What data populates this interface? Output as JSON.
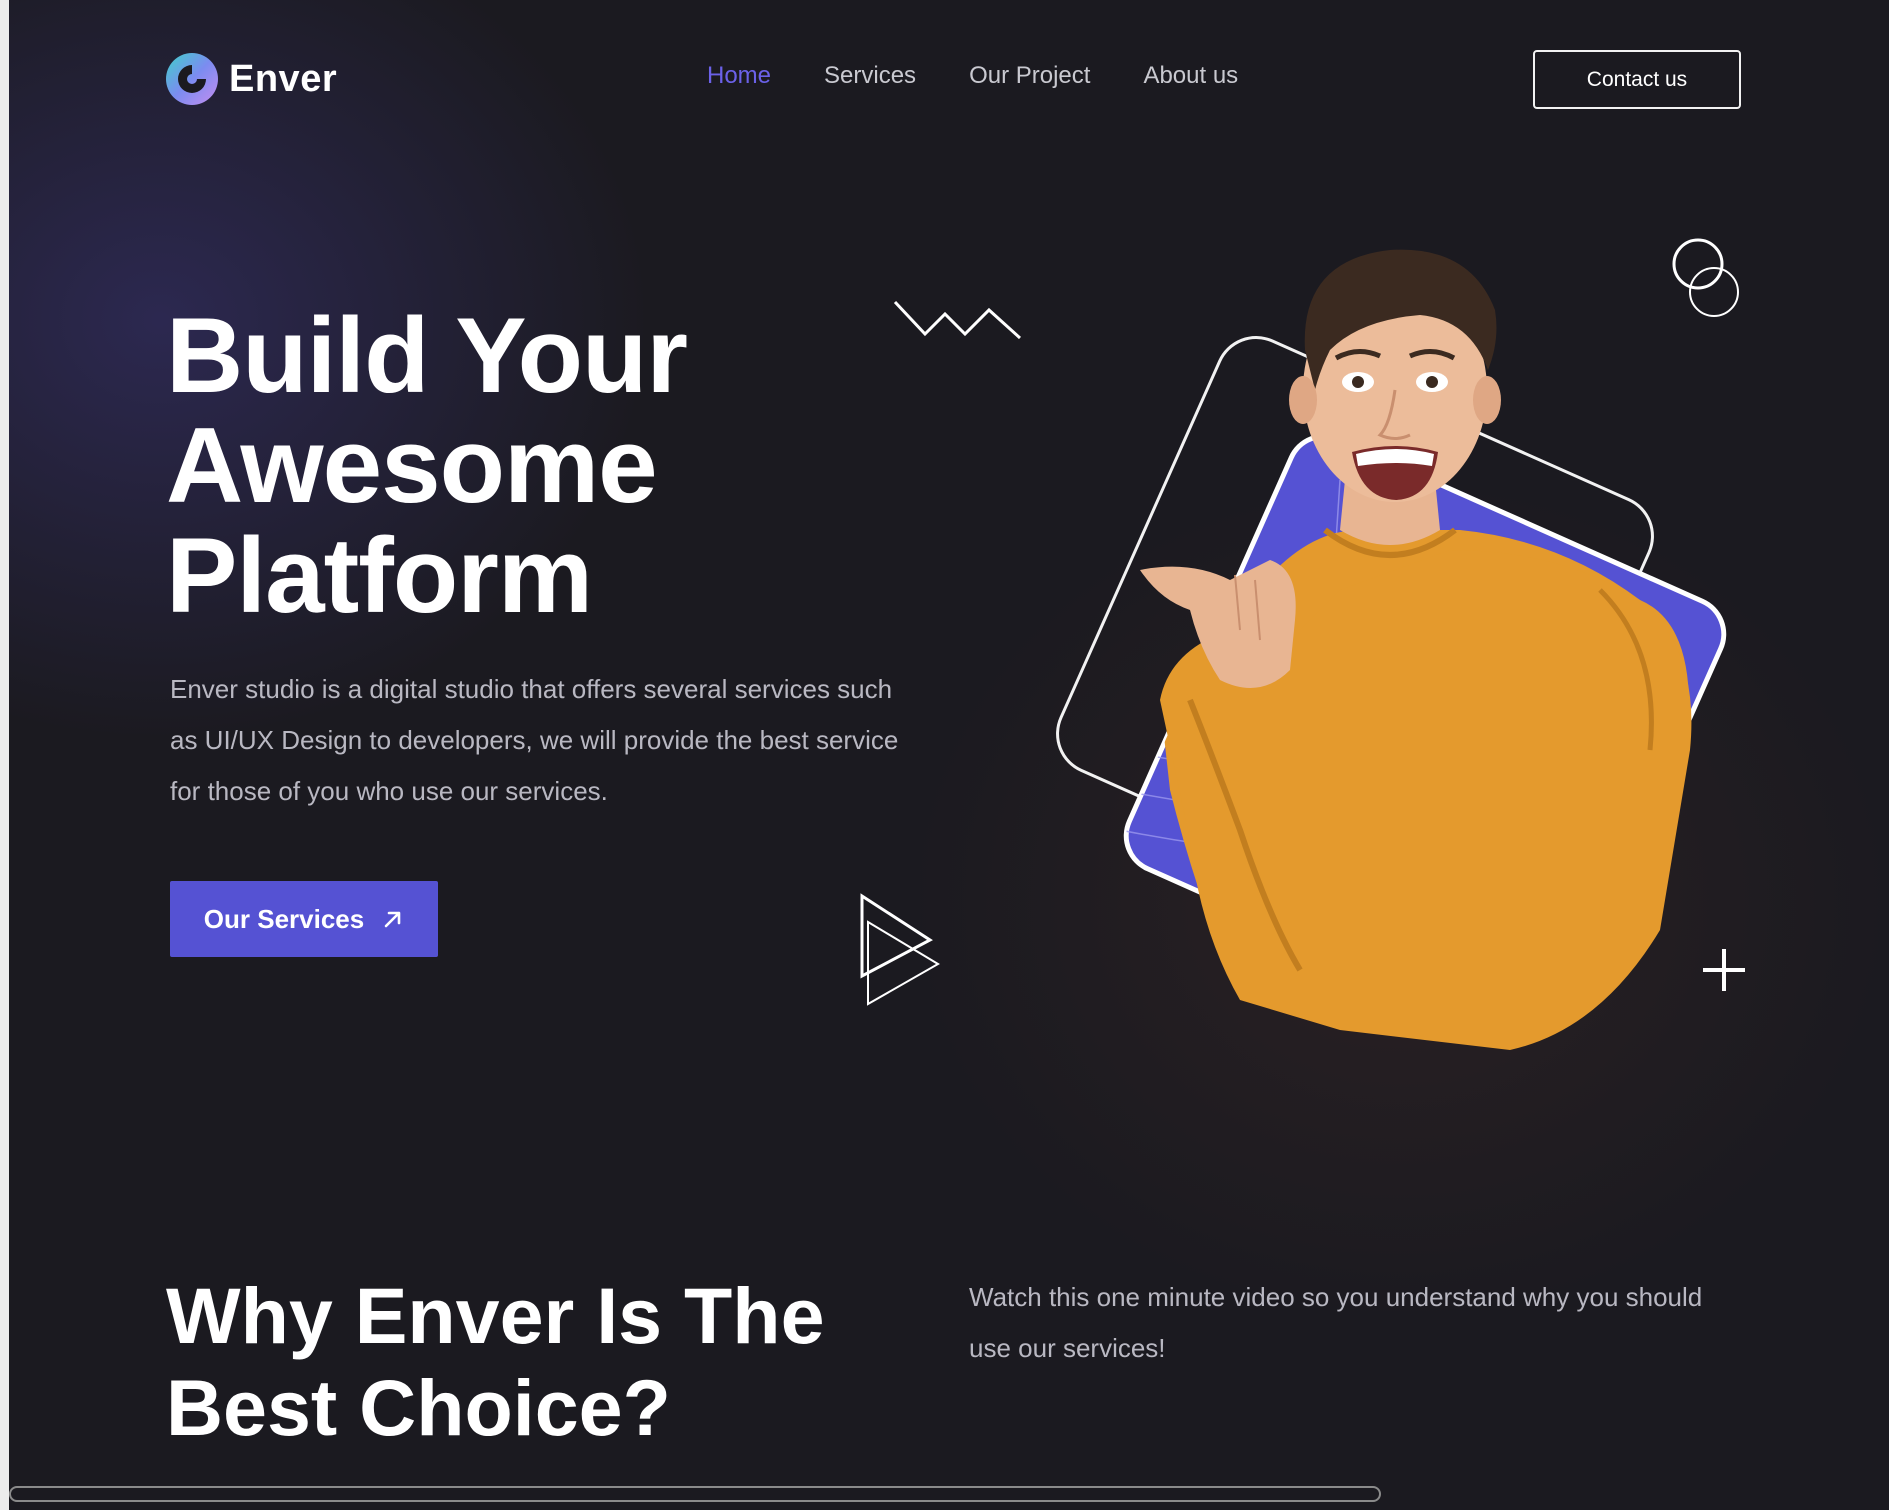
{
  "header": {
    "logo_text": "Enver",
    "nav": [
      {
        "label": "Home",
        "active": true
      },
      {
        "label": "Services",
        "active": false
      },
      {
        "label": "Our Project",
        "active": false
      },
      {
        "label": "About us",
        "active": false
      }
    ],
    "contact_label": "Contact us"
  },
  "hero": {
    "title_lines": [
      "Build Your",
      "Awesome",
      "Platform"
    ],
    "description": "Enver studio is a digital studio that offers several services such as UI/UX Design to developers, we will provide the best service for those of you who use our services.",
    "cta_label": "Our Services",
    "cta_icon": "arrow-up-right-icon"
  },
  "why": {
    "title_lines": [
      "Why Enver Is The",
      "Best Choice?"
    ],
    "description": "Watch this one minute video so you understand why you should use our services!"
  },
  "colors": {
    "accent": "#5552d3",
    "nav_active": "#6b61e8",
    "background": "#1b1a20",
    "sweater": "#e49a2d"
  }
}
